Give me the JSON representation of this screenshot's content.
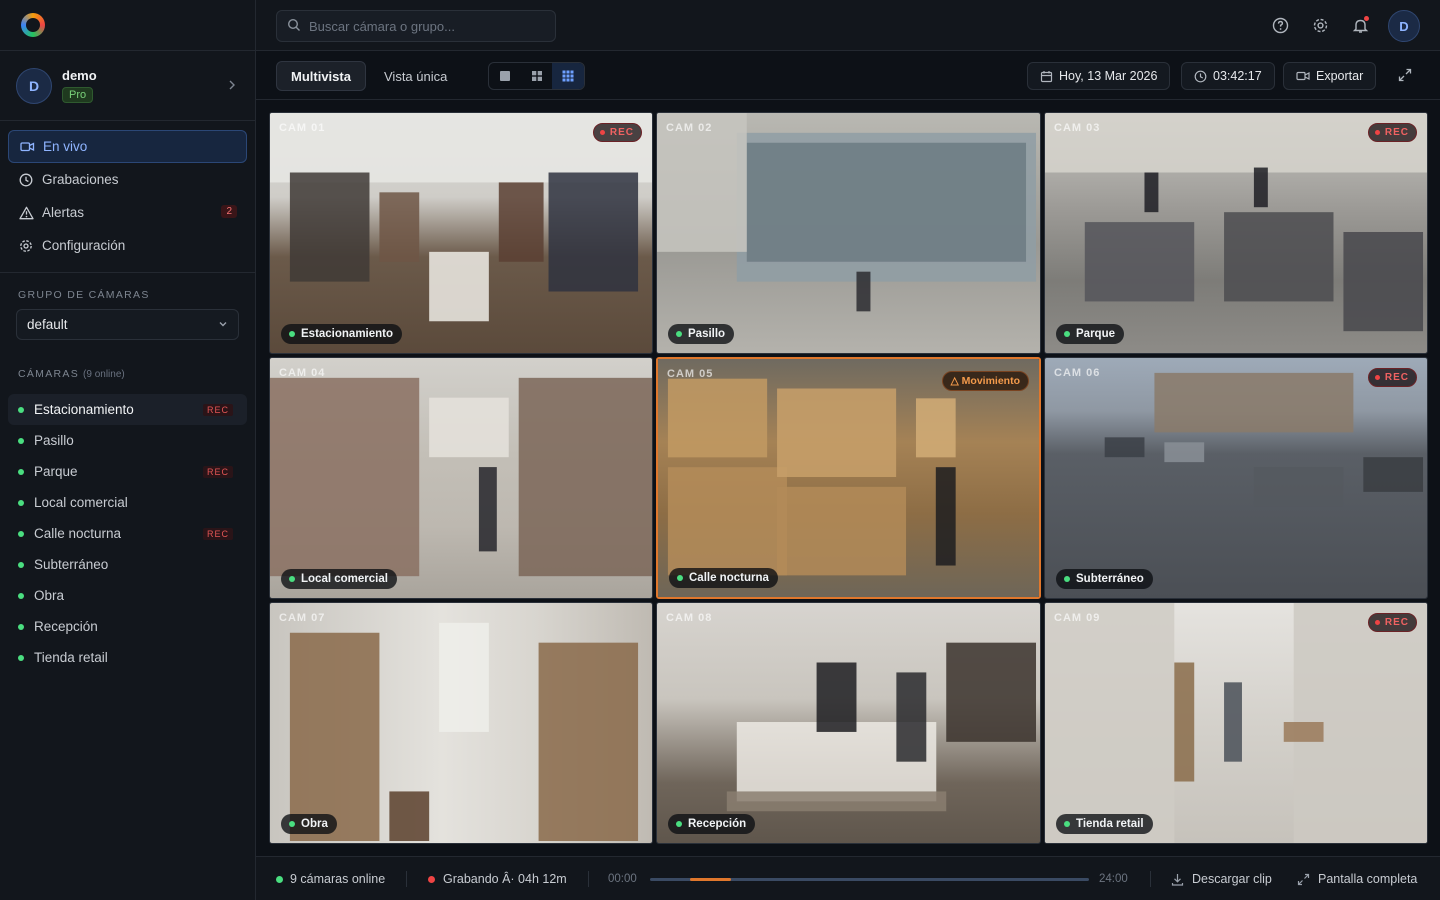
{
  "sidebar": {
    "user": {
      "initial": "D",
      "name": "demo",
      "plan": "Pro"
    },
    "nav": [
      {
        "label": "En vivo",
        "icon": "video-icon",
        "active": true
      },
      {
        "label": "Grabaciones",
        "icon": "clock-icon"
      },
      {
        "label": "Alertas",
        "icon": "warning-icon",
        "count": "2"
      },
      {
        "label": "Configuración",
        "icon": "gear-icon"
      }
    ],
    "group_label": "GRUPO DE CÁMARAS",
    "group_value": "default",
    "cameras_label": "CÁMARAS",
    "cameras_online": "(9 online)",
    "rec_label": "REC",
    "cameras": [
      {
        "name": "Estacionamiento",
        "rec": true,
        "active": true
      },
      {
        "name": "Pasillo",
        "rec": false
      },
      {
        "name": "Parque",
        "rec": true
      },
      {
        "name": "Local comercial",
        "rec": false
      },
      {
        "name": "Calle nocturna",
        "rec": true
      },
      {
        "name": "Subterráneo",
        "rec": false
      },
      {
        "name": "Obra",
        "rec": false
      },
      {
        "name": "Recepción",
        "rec": false
      },
      {
        "name": "Tienda retail",
        "rec": false
      }
    ]
  },
  "topbar": {
    "search_placeholder": "Buscar cámara o grupo...",
    "avatar_initial": "D"
  },
  "toolbar": {
    "tab_multi": "Multivista",
    "tab_single": "Vista única",
    "active_layout": "3x3",
    "date": "Hoy, 13 Mar 2026",
    "time": "03:42:17",
    "export": "Exportar"
  },
  "tiles": [
    {
      "cam": "CAM 01",
      "name": "Estacionamiento",
      "rec": true,
      "scene": "s-store"
    },
    {
      "cam": "CAM 02",
      "name": "Pasillo",
      "rec": false,
      "scene": "s-front"
    },
    {
      "cam": "CAM 03",
      "name": "Parque",
      "rec": true,
      "scene": "s-checkout"
    },
    {
      "cam": "CAM 04",
      "name": "Local comercial",
      "rec": false,
      "scene": "s-aisle"
    },
    {
      "cam": "CAM 05",
      "name": "Calle nocturna",
      "rec": false,
      "motion": "Movimiento",
      "scene": "s-warehouse"
    },
    {
      "cam": "CAM 06",
      "name": "Subterráneo",
      "rec": true,
      "scene": "s-parking"
    },
    {
      "cam": "CAM 07",
      "name": "Obra",
      "rec": false,
      "scene": "s-hall"
    },
    {
      "cam": "CAM 08",
      "name": "Recepción",
      "rec": false,
      "scene": "s-reception"
    },
    {
      "cam": "CAM 09",
      "name": "Tienda retail",
      "rec": true,
      "scene": "s-corridor"
    }
  ],
  "tile_rec_label": "REC",
  "bottombar": {
    "online": "9 cámaras online",
    "recording": "Grabando Â· 04h 12m",
    "time_start": "00:00",
    "time_end": "24:00",
    "timeline_segment": [
      0.09,
      0.185
    ],
    "download": "Descargar clip",
    "fullscreen": "Pantalla completa"
  },
  "colors": {
    "accent": "#6ea0ff",
    "alert": "#e0772c",
    "rec": "#ef4444",
    "online": "#4ade80"
  }
}
